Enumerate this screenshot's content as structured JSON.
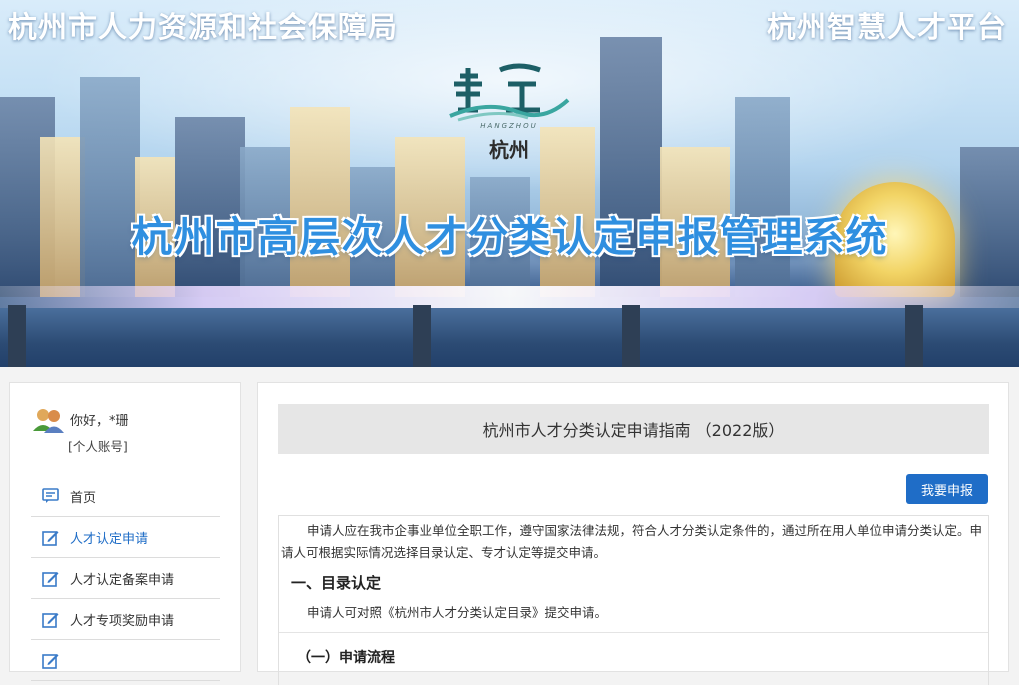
{
  "banner": {
    "left_title": "杭州市人力资源和社会保障局",
    "right_title": "杭州智慧人才平台",
    "logo_pinyin": "HANGZHOU",
    "logo_city": "杭州",
    "system_title": "杭州市高层次人才分类认定申报管理系统"
  },
  "user": {
    "greeting": "你好，*珊",
    "account_link": "[个人账号]"
  },
  "sidebar": {
    "items": [
      {
        "label": "首页",
        "icon": "message-icon",
        "active": false
      },
      {
        "label": "人才认定申请",
        "icon": "edit-icon",
        "active": true
      },
      {
        "label": "人才认定备案申请",
        "icon": "edit-icon",
        "active": false
      },
      {
        "label": "人才专项奖励申请",
        "icon": "edit-icon",
        "active": false
      },
      {
        "label": "",
        "icon": "edit-icon",
        "active": false
      }
    ]
  },
  "main": {
    "guide_title": "杭州市人才分类认定申请指南 （2022版）",
    "apply_button": "我要申报",
    "intro": "申请人应在我市企事业单位全职工作，遵守国家法律法规，符合人才分类认定条件的，通过所在用人单位申请分类认定。申请人可根据实际情况选择目录认定、专才认定等提交申请。",
    "section1_heading": "一、目录认定",
    "section1_text": "申请人可对照《杭州市人才分类认定目录》提交申请。",
    "subsection_heading": "（一）申请流程"
  },
  "colors": {
    "accent": "#1f6dc7",
    "title_blue": "#2f8fe0",
    "panel_gray": "#e6e6e6"
  }
}
